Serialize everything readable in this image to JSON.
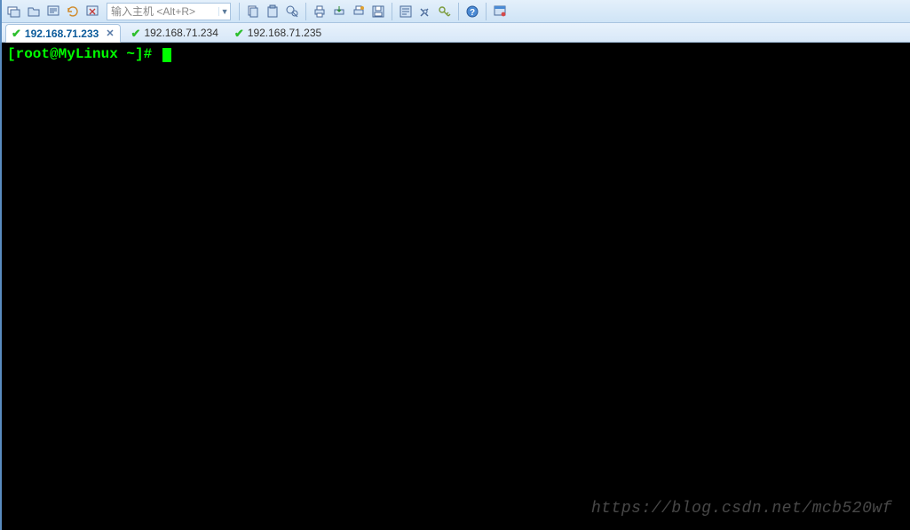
{
  "toolbar": {
    "host_placeholder": "输入主机 <Alt+R>"
  },
  "tabs": {
    "items": [
      {
        "label": "192.168.71.233",
        "active": true
      },
      {
        "label": "192.168.71.234",
        "active": false
      },
      {
        "label": "192.168.71.235",
        "active": false
      }
    ]
  },
  "terminal": {
    "prompt": "[root@MyLinux ~]#"
  },
  "watermark": "https://blog.csdn.net/mcb520wf"
}
